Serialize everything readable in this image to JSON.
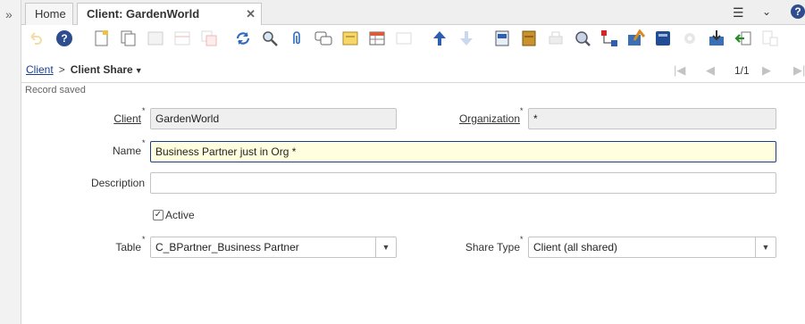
{
  "tabs": {
    "home": "Home",
    "active": "Client: GardenWorld Garden..."
  },
  "window_icons": {
    "menu": "hamburger-menu-icon",
    "collapse": "double-chevron-down-icon",
    "help": "?"
  },
  "breadcrumb": {
    "parent": "Client",
    "separator": ">",
    "current": "Client Share"
  },
  "record": {
    "counter": "1/1"
  },
  "status": "Record saved",
  "form": {
    "client_label": "Client",
    "client_value": "GardenWorld",
    "organization_label": "Organization",
    "organization_value": "*",
    "name_label": "Name",
    "name_value": "Business Partner just in Org *",
    "description_label": "Description",
    "description_value": "",
    "active_label": "Active",
    "active_checked": true,
    "table_label": "Table",
    "table_value": "C_BPartner_Business Partner",
    "share_type_label": "Share Type",
    "share_type_value": "Client (all shared)"
  },
  "colors": {
    "link": "#1b3f8f",
    "focus_border": "#1e3c8f",
    "focus_bg": "#ffffdf",
    "readonly_bg": "#efefef"
  }
}
